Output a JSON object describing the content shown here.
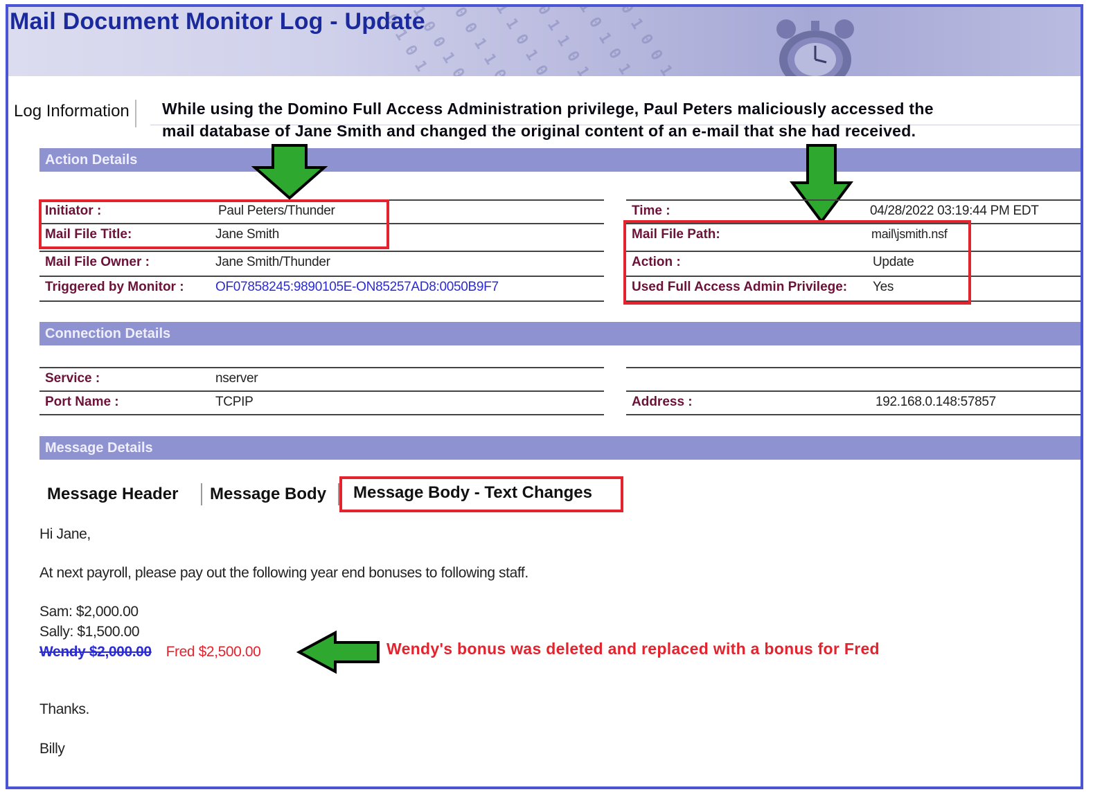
{
  "window": {
    "title": "Mail Document Monitor Log - Update"
  },
  "tab": {
    "label": "Log Information"
  },
  "annotations": {
    "top_line1": "While using the Domino Full Access Administration privilege, Paul Peters maliciously accessed the",
    "top_line2": "mail database of Jane Smith and changed the original content of an e-mail that she had received.",
    "bottom": "Wendy's bonus was deleted and replaced with a bonus for Fred"
  },
  "sections": {
    "action": "Action Details",
    "connection": "Connection Details",
    "message": "Message Details"
  },
  "action_details": {
    "left": [
      {
        "label": "Initiator :",
        "value": "Paul Peters/Thunder"
      },
      {
        "label": "Mail File Title:",
        "value": "Jane Smith"
      },
      {
        "label": "Mail File Owner :",
        "value": "Jane Smith/Thunder"
      },
      {
        "label": "Triggered by Monitor :",
        "value": "OF07858245:9890105E-ON85257AD8:0050B9F7"
      }
    ],
    "right": [
      {
        "label": "Time :",
        "value": "04/28/2022 03:19:44 PM EDT"
      },
      {
        "label": "Mail File Path:",
        "value": "mail\\jsmith.nsf"
      },
      {
        "label": "Action :",
        "value": "Update"
      },
      {
        "label": "Used Full Access Admin Privilege:",
        "value": "Yes"
      }
    ]
  },
  "connection_details": {
    "left": [
      {
        "label": "Service :",
        "value": "nserver"
      },
      {
        "label": "Port Name :",
        "value": "TCPIP"
      }
    ],
    "right": [
      {
        "label": "Address :",
        "value": "192.168.0.148:57857"
      }
    ]
  },
  "message_tabs": [
    "Message Header",
    "Message Body",
    "Message Body - Text Changes"
  ],
  "message": {
    "greeting": "Hi Jane,",
    "body": "At next payroll, please pay out the following year end bonuses to following staff.",
    "line_sam": "Sam: $2,000.00",
    "line_sally": "Sally: $1,500.00",
    "deleted": "Wendy $2,000.00",
    "inserted": "Fred $2,500.00",
    "thanks": "Thanks.",
    "signature": "Billy"
  },
  "colors": {
    "frame": "#4a55d6",
    "section_bar": "#8f92d0",
    "label": "#6b1238",
    "highlight_box": "#e3232d",
    "arrow": "#2fa82f",
    "link": "#2b2bd6"
  },
  "icons": [
    "clock-icon",
    "down-arrow-icon",
    "left-arrow-icon"
  ]
}
